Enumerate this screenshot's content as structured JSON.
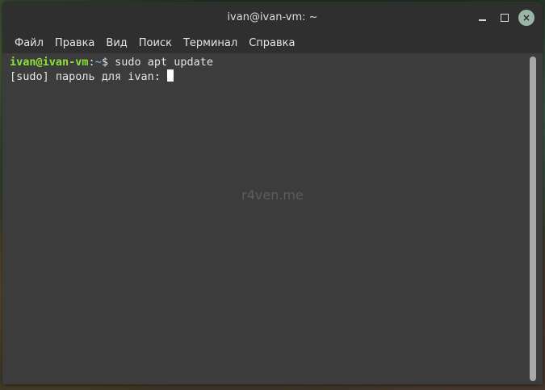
{
  "window": {
    "title": "ivan@ivan-vm: ~",
    "controls": {
      "minimize_icon": "minimize-icon",
      "maximize_icon": "maximize-icon",
      "close_icon": "close-icon",
      "close_glyph": "×"
    }
  },
  "menu": {
    "items": [
      {
        "label": "Файл"
      },
      {
        "label": "Правка"
      },
      {
        "label": "Вид"
      },
      {
        "label": "Поиск"
      },
      {
        "label": "Терминал"
      },
      {
        "label": "Справка"
      }
    ]
  },
  "terminal": {
    "line1": {
      "user_host": "ivan@ivan-vm",
      "separator": ":",
      "path": "~",
      "prompt_symbol": "$",
      "command": " sudo apt update"
    },
    "line2": {
      "text": "[sudo] пароль для ivan: "
    },
    "watermark": "r4ven.me"
  },
  "colors": {
    "prompt_user": "#8ae234",
    "prompt_path": "#729fcf",
    "terminal_bg": "#3c3c3c",
    "titlebar_bg": "#2f2f2f",
    "close_button": "#9ab6a9"
  }
}
